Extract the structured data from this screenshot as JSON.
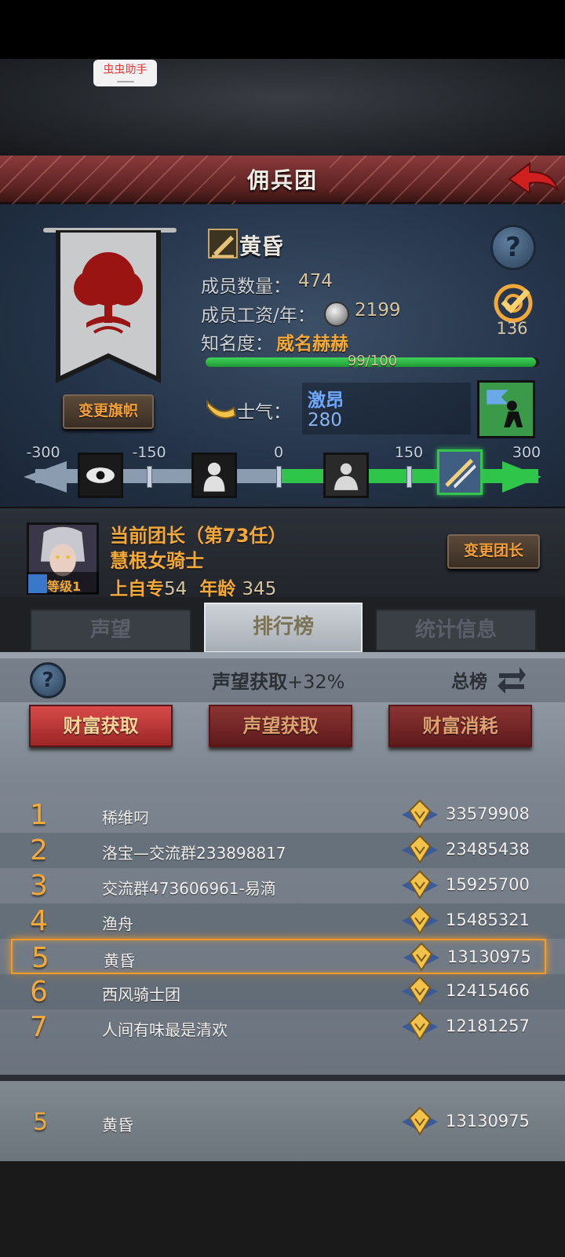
{
  "helper": {
    "label": "虫虫助手"
  },
  "header": {
    "title": "佣兵团"
  },
  "guild": {
    "name": "黄昏",
    "members_label": "成员数量：",
    "members_value": "474",
    "wage_label": "成员工资/年：",
    "wage_value": "2199",
    "fame_label": "知名度：",
    "fame_value": "威名赫赫",
    "fame_progress_text": "99/100",
    "fame_progress_fraction": 0.99,
    "target_value": "136",
    "change_banner_label": "变更旗帜",
    "morale_label": "士气：",
    "morale_state": "激昂",
    "morale_value": "280"
  },
  "morale_scale": {
    "ticks": [
      "-300",
      "-150",
      "0",
      "150",
      "300"
    ],
    "icons": [
      "eye-icon",
      "fear-icon",
      "calm-icon",
      "charge-icon"
    ],
    "selected_index": 3
  },
  "leader": {
    "title": "当前团长（第73任）",
    "name": "慧根女骑士",
    "level_label": "等级1",
    "origin_label": "上自专",
    "origin_value": "54",
    "age_label": "年龄",
    "age_value": "345",
    "change_label": "变更团长"
  },
  "tabs": [
    {
      "label": "声望",
      "active": false
    },
    {
      "label": "排行榜",
      "active": true
    },
    {
      "label": "统计信息",
      "active": false
    }
  ],
  "ranking": {
    "bonus_label": "声望获取",
    "bonus_value": "+32%",
    "scope_label": "总榜",
    "categories": [
      {
        "label": "财富获取",
        "active": true
      },
      {
        "label": "声望获取",
        "active": false
      },
      {
        "label": "财富消耗",
        "active": false
      }
    ],
    "rows": [
      {
        "rank": "1",
        "name": "稀维叼",
        "value": "33579908"
      },
      {
        "rank": "2",
        "name": "洛宝—交流群233898817",
        "value": "23485438"
      },
      {
        "rank": "3",
        "name": "交流群473606961-易滴",
        "value": "15925700"
      },
      {
        "rank": "4",
        "name": "渔舟",
        "value": "15485321"
      },
      {
        "rank": "5",
        "name": "黄昏",
        "value": "13130975"
      },
      {
        "rank": "6",
        "name": "西风骑士团",
        "value": "12415466"
      },
      {
        "rank": "7",
        "name": "人间有味最是清欢",
        "value": "12181257"
      }
    ],
    "own": {
      "rank": "5",
      "name": "黄昏",
      "value": "13130975"
    }
  }
}
